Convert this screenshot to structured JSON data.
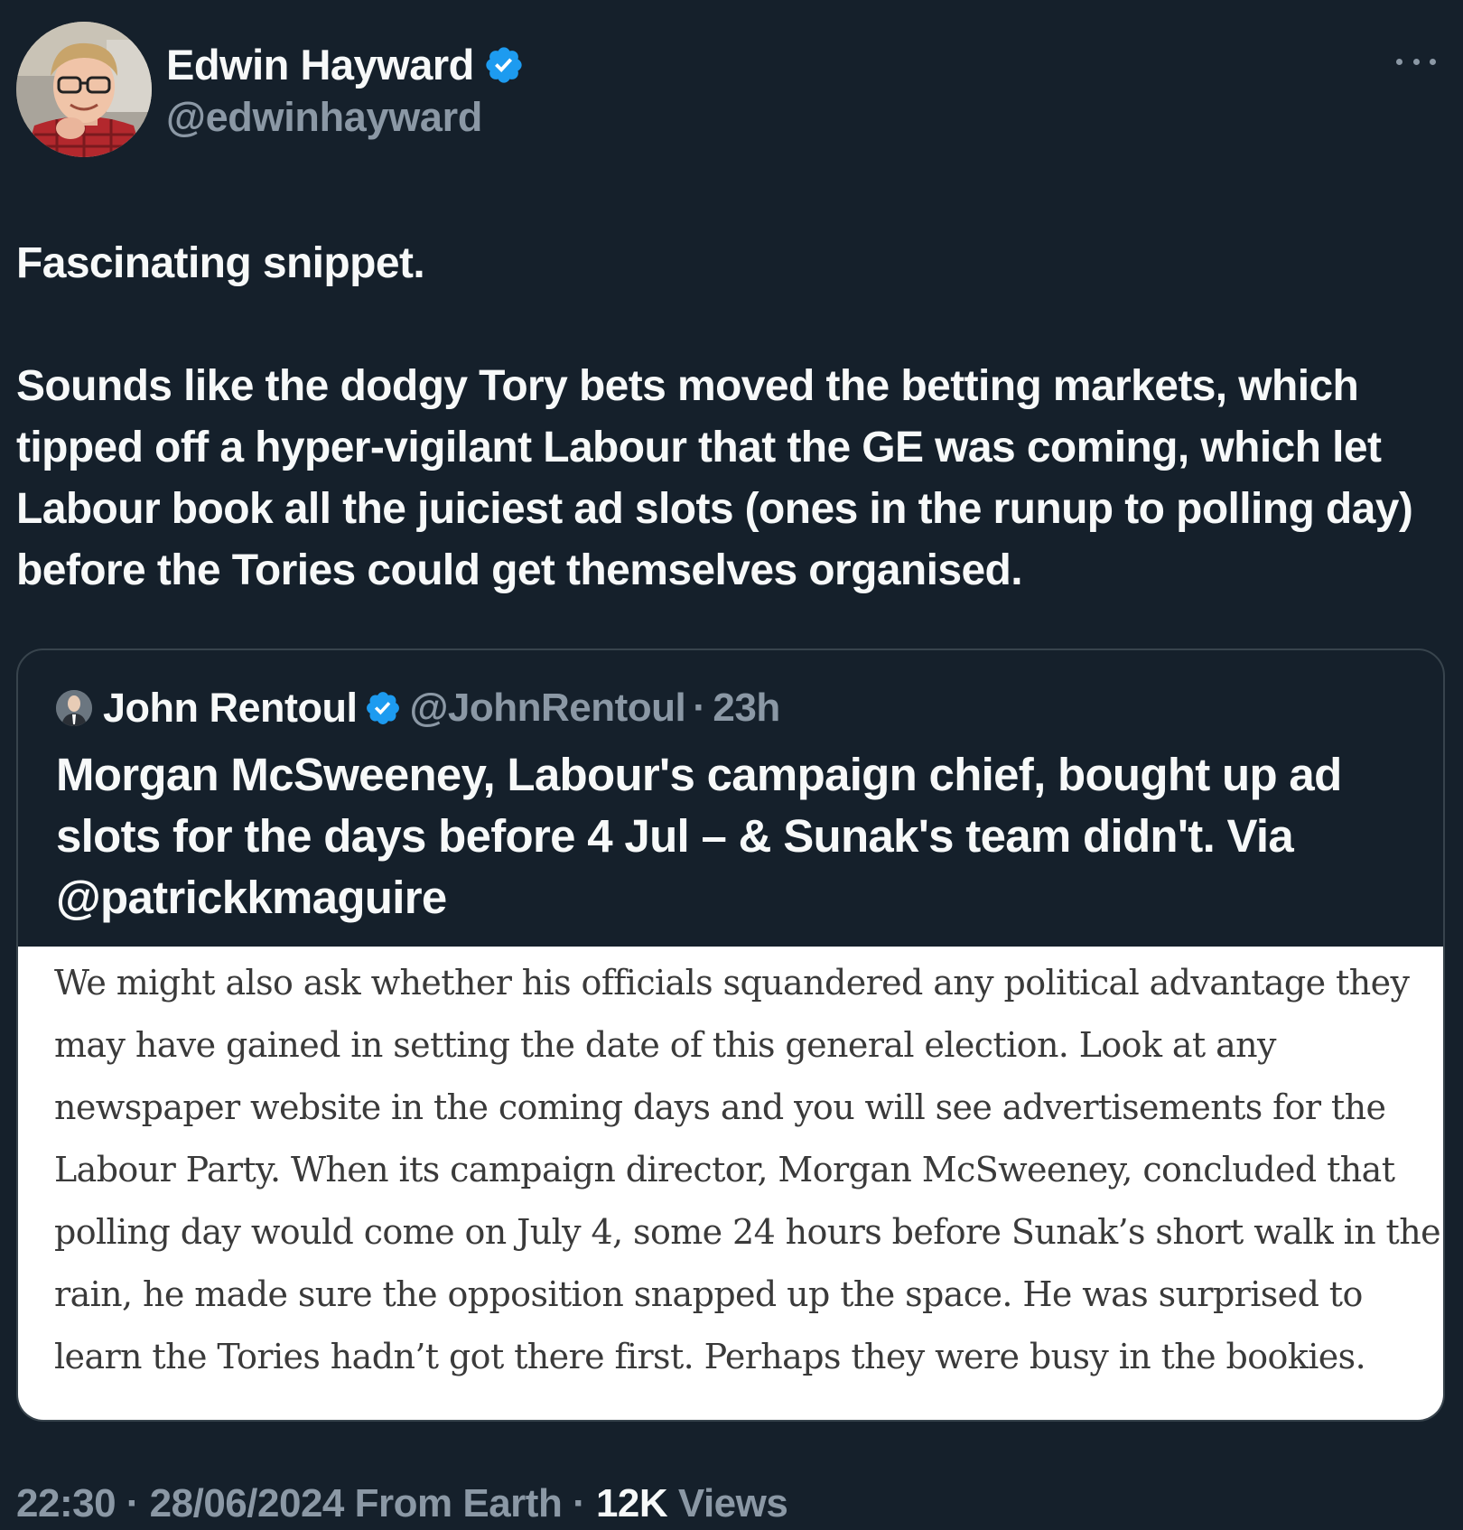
{
  "author": {
    "name": "Edwin Hayward",
    "handle": "@edwinhayward",
    "verified": true
  },
  "tweet": {
    "paragraphs": [
      "Fascinating snippet.",
      "Sounds like the dodgy Tory bets moved the betting markets, which tipped off a hyper-vigilant Labour that the GE was coming, which let Labour book all the juiciest ad slots (ones in the runup to polling day) before the Tories could get themselves organised."
    ]
  },
  "quote": {
    "name": "John Rentoul",
    "handle": "@JohnRentoul",
    "separator": "·",
    "time": "23h",
    "text": "Morgan McSweeney, Labour's campaign chief, bought up ad slots for the days before 4 Jul – & Sunak's team didn't. Via @patrickkmaguire",
    "image_text": "We might also ask whether his officials squandered any political advantage they may have gained in setting the date of this general election. Look at any newspaper website in the coming days and you will see advertisements for the Labour Party. When its campaign director, Morgan McSweeney, concluded that polling day would come on July 4, some 24 hours before Sunak’s short walk in the rain, he made sure the opposition snapped up the space. He was surprised to learn the Tories hadn’t got there first. Perhaps they were busy in the bookies."
  },
  "footer": {
    "time": "22:30",
    "separator": "·",
    "date": "28/06/2024",
    "source": "From Earth",
    "views_count": "12K",
    "views_label": "Views"
  },
  "colors": {
    "background": "#15202b",
    "text": "#f7f9f9",
    "secondary": "#8b98a5",
    "verified": "#1d9bf0",
    "border": "#38444d"
  },
  "icons": {
    "verified": "verified-badge-icon",
    "more": "more-dots-icon"
  }
}
